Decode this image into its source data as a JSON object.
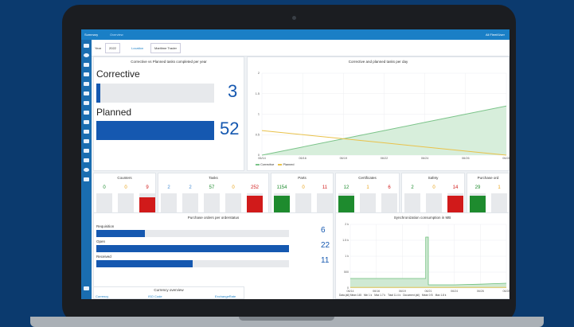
{
  "topbar": {
    "crumb1": "Summary",
    "crumb2": "Overview",
    "right": "All Fleet/User"
  },
  "filters": {
    "year_label": "Year",
    "year_value": "2022",
    "location_label": "Location",
    "location_value": "Maritime Trader"
  },
  "colors": {
    "green": "#1e8b2e",
    "red": "#d11a1a",
    "blue": "#1558b0",
    "orange": "#e9a31b"
  },
  "cvp": {
    "title": "Corrective vs Planned tasks completed per year",
    "corrective_label": "Corrective",
    "corrective_value": "3",
    "planned_label": "Planned",
    "planned_value": "52"
  },
  "line_chart": {
    "title": "Corrective and planned tasks per day",
    "legend_corrective": "Corrective",
    "legend_planned": "Planned",
    "chart_data": {
      "type": "area",
      "x": [
        "06/14",
        "06/16",
        "06/19",
        "06/22",
        "06/24",
        "06/26",
        "06/28"
      ],
      "yticks": [
        "2",
        "1.5",
        "1",
        "0.5",
        "0"
      ],
      "series": [
        {
          "name": "Corrective",
          "values": [
            0,
            0.2,
            0.4,
            0.6,
            0.8,
            1.0,
            1.2
          ]
        },
        {
          "name": "Planned",
          "values": [
            0.6,
            0.5,
            0.4,
            0.3,
            0.2,
            0.1,
            0
          ]
        }
      ]
    }
  },
  "counters": {
    "title": "Counters",
    "values": [
      "0",
      "0",
      "9"
    ],
    "labels": [
      "Ok",
      "Due",
      "Overdue"
    ],
    "fills": [
      0,
      0,
      0.9
    ]
  },
  "tasks": {
    "title": "Tasks",
    "values": [
      "2",
      "2",
      "57",
      "0",
      "252"
    ],
    "labels": [
      "Defects",
      "Blocking",
      "Ok",
      "Due",
      "Overdue"
    ],
    "fills": [
      0,
      0.05,
      0.22,
      0,
      0.95
    ]
  },
  "parts": {
    "title": "Parts",
    "values": [
      "1154",
      "0",
      "11"
    ],
    "labels": [
      "Ok",
      "Due",
      "Overdue"
    ],
    "fills": [
      0.95,
      0,
      0.04
    ]
  },
  "certificates": {
    "title": "Certificates",
    "values": [
      "12",
      "1",
      "6"
    ],
    "labels": [
      "Ok",
      "Due",
      "Overdue"
    ],
    "fills": [
      0.95,
      0.05,
      0.45
    ]
  },
  "safety": {
    "title": "Safety",
    "values": [
      "2",
      "0",
      "14"
    ],
    "labels": [
      "Ok",
      "Due",
      "Overdue"
    ],
    "fills": [
      0.08,
      0,
      0.95
    ]
  },
  "purchase_orders": {
    "title": "Purchase ord",
    "values": [
      "29",
      "1"
    ],
    "labels": [
      "Pending",
      "Unread"
    ],
    "fills": [
      0.95,
      0.05
    ]
  },
  "po_status": {
    "title": "Purchase orders per orderstatus",
    "rows": [
      {
        "label": "Requisition",
        "value": "6",
        "fill": 0.25
      },
      {
        "label": "Open",
        "value": "22",
        "fill": 1.0
      },
      {
        "label": "Received",
        "value": "11",
        "fill": 0.5
      }
    ]
  },
  "currency": {
    "title": "Currency overview",
    "cols": [
      "Currency",
      "ISO Code",
      "ExchangeRate"
    ]
  },
  "sync": {
    "title": "Synchronization consumption in MB",
    "chart_data": {
      "type": "area",
      "x": [
        "06/14",
        "06/16",
        "06/19",
        "06/21",
        "06/24",
        "06/26",
        "06/28"
      ],
      "yticks": [
        "2 k",
        "1.5 k",
        "1 k",
        "500",
        "0"
      ],
      "series": [
        {
          "name": "Data (all)",
          "values": [
            300,
            300,
            300,
            1600,
            100,
            120,
            150
          ]
        },
        {
          "name": "Document (all)",
          "values": [
            20,
            20,
            20,
            20,
            20,
            20,
            20
          ]
        }
      ]
    },
    "legend": [
      "Data (all) Mean 145",
      "Min 1 k",
      "Max 1.7 k",
      "Total 11.4 k",
      "Document (all)",
      "Mean 0 B",
      "Max 1.8 k"
    ]
  }
}
